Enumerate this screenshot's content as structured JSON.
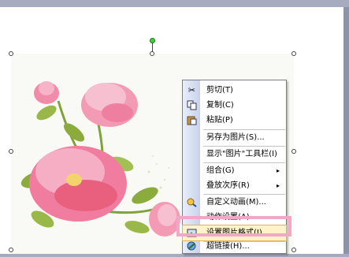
{
  "context_menu": {
    "items": [
      {
        "label": "剪切(T)",
        "icon": "scissors-icon",
        "submenu": false
      },
      {
        "label": "复制(C)",
        "icon": "copy-icon",
        "submenu": false
      },
      {
        "label": "粘贴(P)",
        "icon": "paste-icon",
        "submenu": false
      },
      {
        "label": "另存为图片(S)...",
        "icon": "",
        "submenu": false
      },
      {
        "label": "显示\"图片\"工具栏(I)",
        "icon": "",
        "submenu": false
      },
      {
        "label": "组合(G)",
        "icon": "",
        "submenu": true
      },
      {
        "label": "叠放次序(R)",
        "icon": "",
        "submenu": true
      },
      {
        "label": "自定义动画(M)...",
        "icon": "custom-animation-icon",
        "submenu": false
      },
      {
        "label": "动作设置(A)...",
        "icon": "",
        "submenu": false
      },
      {
        "label": "设置图片格式(I)...",
        "icon": "format-picture-icon",
        "submenu": false,
        "highlighted": true
      },
      {
        "label": "超链接(H)...",
        "icon": "hyperlink-icon",
        "submenu": false
      }
    ],
    "submenu_arrow": "▸"
  },
  "colors": {
    "highlight_box": "#f2a7c6",
    "selection_handle_rotate": "#3fcf3f",
    "menu_hover": "#fff1c8"
  }
}
